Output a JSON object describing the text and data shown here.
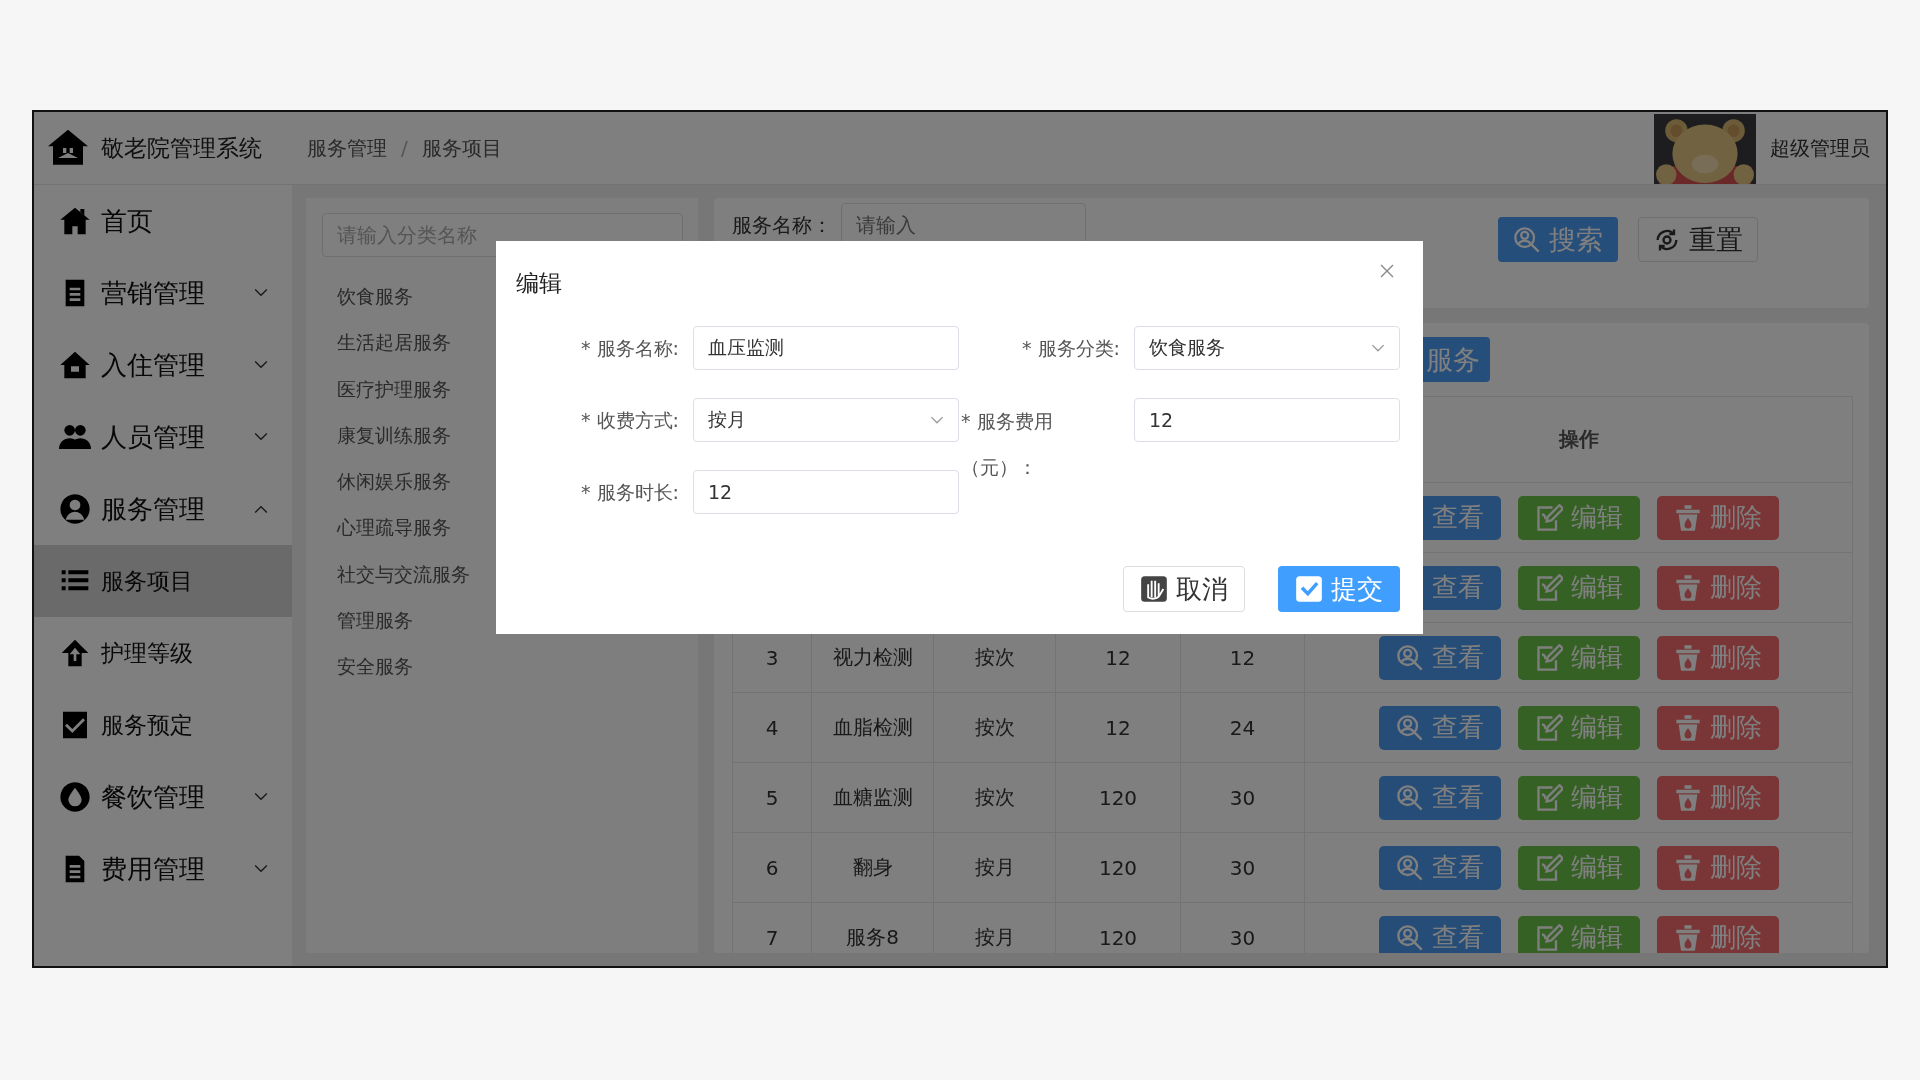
{
  "app_title": "敬老院管理系统",
  "breadcrumb": {
    "items": [
      "服务管理",
      "服务项目"
    ],
    "separator": "/"
  },
  "user": {
    "name": "超级管理员"
  },
  "sidebar": {
    "items": [
      {
        "label": "首页",
        "selected": false
      },
      {
        "label": "营销管理",
        "selected": false,
        "expanded": false
      },
      {
        "label": "入住管理",
        "selected": false,
        "expanded": false
      },
      {
        "label": "人员管理",
        "selected": false,
        "expanded": false
      },
      {
        "label": "服务管理",
        "selected": false,
        "expanded": true,
        "children": [
          {
            "label": "服务项目",
            "selected": true
          },
          {
            "label": "护理等级",
            "selected": false
          },
          {
            "label": "服务预定",
            "selected": false
          }
        ]
      },
      {
        "label": "餐饮管理",
        "selected": false,
        "expanded": false
      },
      {
        "label": "费用管理",
        "selected": false,
        "expanded": false
      }
    ]
  },
  "category_panel": {
    "search": {
      "placeholder": "请输入分类名称"
    },
    "items": [
      "饮食服务",
      "生活起居服务",
      "医疗护理服务",
      "康复训练服务",
      "休闲娱乐服务",
      "心理疏导服务",
      "社交与交流服务",
      "管理服务",
      "安全服务"
    ]
  },
  "search_form": {
    "label": "服务名称：",
    "field": {
      "placeholder": "请输入"
    },
    "buttons": [
      {
        "label": "搜索",
        "kind": "primary"
      },
      {
        "label": "重置",
        "kind": "default"
      }
    ]
  },
  "add_button": {
    "label": "服务"
  },
  "table": {
    "action_header": "操作",
    "rows": [
      {
        "actions": [
          {
            "label": "查看",
            "kind": "view"
          },
          {
            "label": "编辑",
            "kind": "edit"
          },
          {
            "label": "删除",
            "kind": "delete"
          }
        ]
      },
      {
        "actions": [
          {
            "label": "查看",
            "kind": "view"
          },
          {
            "label": "编辑",
            "kind": "edit"
          },
          {
            "label": "删除",
            "kind": "delete"
          }
        ]
      },
      {
        "cells": [
          "3",
          "视力检测",
          "按次",
          "12",
          "12"
        ],
        "actions": [
          {
            "label": "查看",
            "kind": "view"
          },
          {
            "label": "编辑",
            "kind": "edit"
          },
          {
            "label": "删除",
            "kind": "delete"
          }
        ]
      },
      {
        "cells": [
          "4",
          "血脂检测",
          "按次",
          "12",
          "24"
        ],
        "actions": [
          {
            "label": "查看",
            "kind": "view"
          },
          {
            "label": "编辑",
            "kind": "edit"
          },
          {
            "label": "删除",
            "kind": "delete"
          }
        ]
      },
      {
        "cells": [
          "5",
          "血糖监测",
          "按次",
          "120",
          "30"
        ],
        "actions": [
          {
            "label": "查看",
            "kind": "view"
          },
          {
            "label": "编辑",
            "kind": "edit"
          },
          {
            "label": "删除",
            "kind": "delete"
          }
        ]
      },
      {
        "cells": [
          "6",
          "翻身",
          "按月",
          "120",
          "30"
        ],
        "actions": [
          {
            "label": "查看",
            "kind": "view"
          },
          {
            "label": "编辑",
            "kind": "edit"
          },
          {
            "label": "删除",
            "kind": "delete"
          }
        ]
      },
      {
        "cells": [
          "7",
          "服务8",
          "按月",
          "120",
          "30"
        ],
        "actions": [
          {
            "label": "查看",
            "kind": "view"
          },
          {
            "label": "编辑",
            "kind": "edit"
          },
          {
            "label": "删除",
            "kind": "delete"
          }
        ]
      }
    ]
  },
  "dialog": {
    "title": "编辑",
    "fields": [
      {
        "label": "* 服务名称:",
        "kind": "input",
        "value": "血压监测"
      },
      {
        "label": "* 服务分类:",
        "kind": "select",
        "value": "饮食服务"
      },
      {
        "label": "* 收费方式:",
        "kind": "select",
        "value": "按月"
      },
      {
        "label": "* 服务费用（元）：",
        "kind": "input",
        "value": "12"
      },
      {
        "label": "* 服务时长:",
        "kind": "input",
        "value": "12"
      }
    ],
    "buttons": [
      {
        "label": "取消",
        "kind": "cancel"
      },
      {
        "label": "提交",
        "kind": "submit"
      }
    ]
  }
}
